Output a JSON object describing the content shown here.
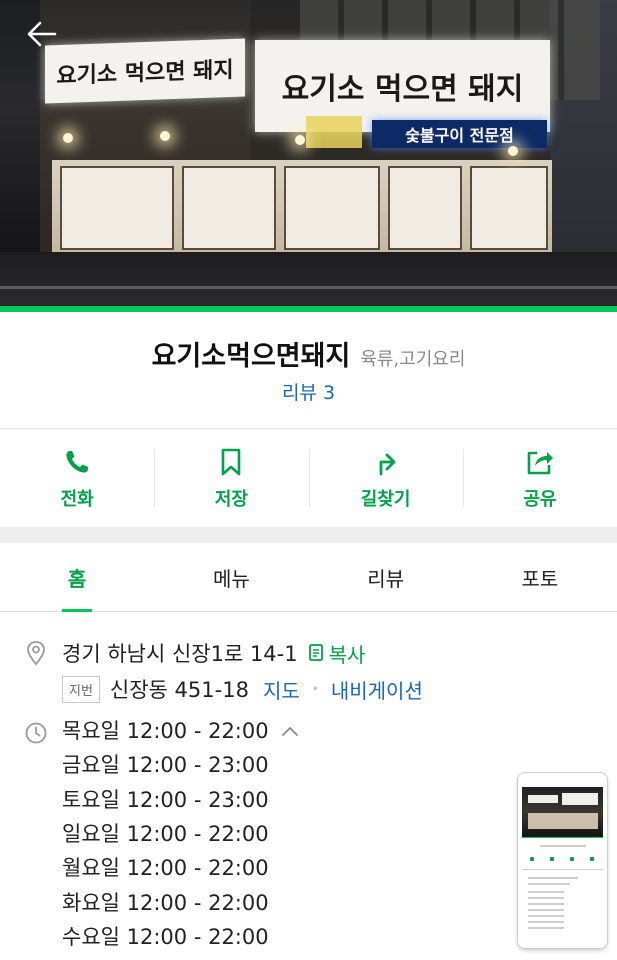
{
  "place": {
    "name": "요기소먹으면돼지",
    "category": "육류,고기요리",
    "review_link": "리뷰 3"
  },
  "hero": {
    "sign_left": "요기소 먹으면 돼지",
    "sign_right": "요기소 먹으면 돼지",
    "sign_blue": "숯불구이 전문점"
  },
  "actions": [
    {
      "label": "전화",
      "icon": "phone-icon"
    },
    {
      "label": "저장",
      "icon": "bookmark-icon"
    },
    {
      "label": "길찾기",
      "icon": "directions-icon"
    },
    {
      "label": "공유",
      "icon": "share-icon"
    }
  ],
  "tabs": [
    {
      "label": "홈",
      "active": true
    },
    {
      "label": "메뉴",
      "active": false
    },
    {
      "label": "리뷰",
      "active": false
    },
    {
      "label": "포토",
      "active": false
    }
  ],
  "address": {
    "road": "경기 하남시 신장1로 14-1",
    "copy_label": "복사",
    "lot_badge": "지번",
    "lot": "신장동 451-18",
    "map_link": "지도",
    "separator": "•",
    "navigation_link": "내비게이션"
  },
  "hours": [
    "목요일 12:00 - 22:00",
    "금요일 12:00 - 23:00",
    "토요일 12:00 - 23:00",
    "일요일 12:00 - 22:00",
    "월요일 12:00 - 22:00",
    "화요일 12:00 - 22:00",
    "수요일 12:00 - 22:00"
  ],
  "colors": {
    "accent_green": "#03c75a",
    "label_green": "#03a14a",
    "link_blue": "#1d67b7"
  }
}
